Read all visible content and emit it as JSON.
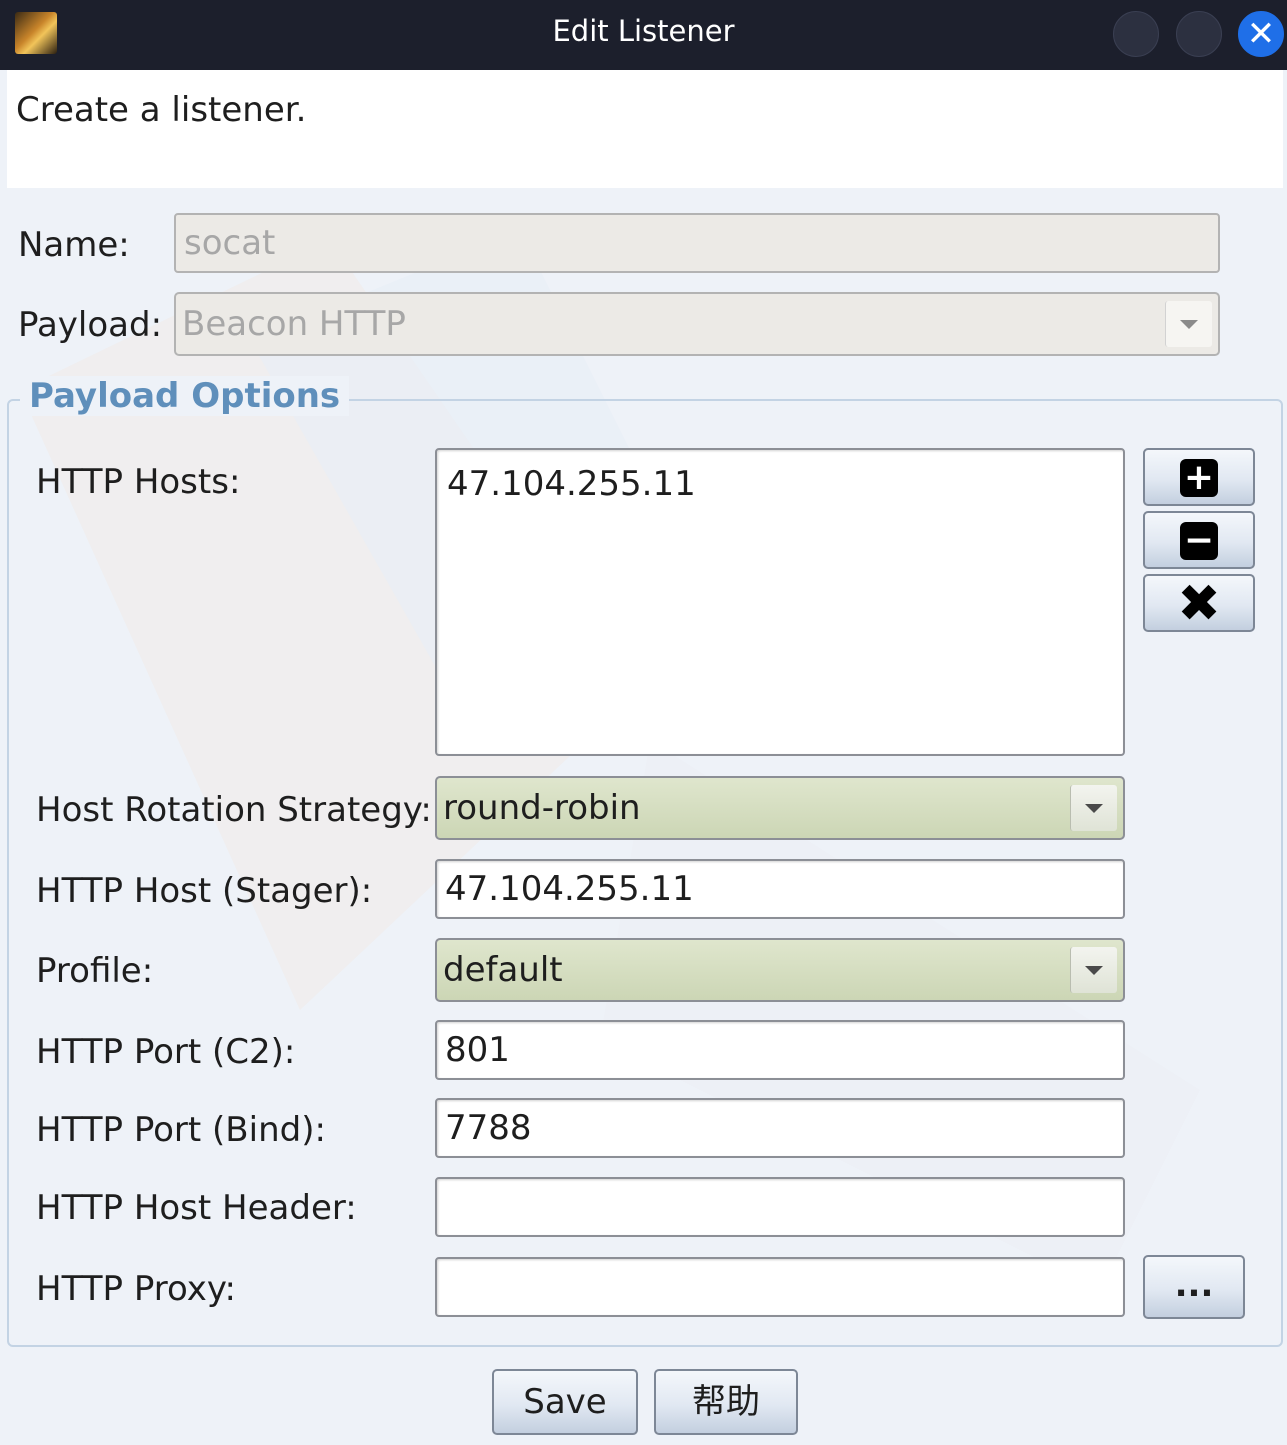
{
  "window": {
    "title": "Edit Listener",
    "close_glyph": "✕",
    "icon": "app-icon"
  },
  "description": "Create a listener.",
  "name_field": {
    "label": "Name:",
    "value": "socat"
  },
  "payload_field": {
    "label": "Payload:",
    "value": "Beacon HTTP"
  },
  "payload_options": {
    "title": "Payload Options",
    "http_hosts": {
      "label": "HTTP Hosts:",
      "items": [
        "47.104.255.11"
      ],
      "add_glyph": "+",
      "remove_glyph": "−",
      "clear_glyph": "✖"
    },
    "host_rotation": {
      "label": "Host Rotation Strategy:",
      "value": "round-robin"
    },
    "http_host_stager": {
      "label": "HTTP Host (Stager):",
      "value": "47.104.255.11"
    },
    "profile": {
      "label": "Profile:",
      "value": "default"
    },
    "http_port_c2": {
      "label": "HTTP Port (C2):",
      "value": "801"
    },
    "http_port_bind": {
      "label": "HTTP Port (Bind):",
      "value": "7788"
    },
    "http_host_header": {
      "label": "HTTP Host Header:",
      "value": ""
    },
    "http_proxy": {
      "label": "HTTP Proxy:",
      "value": "",
      "browse_label": "..."
    }
  },
  "buttons": {
    "save": "Save",
    "help": "帮助"
  },
  "colors": {
    "titlebar": "#1c1f2c",
    "close_button": "#1f6fe8",
    "group_title": "#5f8fbb",
    "combo_bg": "#d6debf",
    "background": "#eef2f8"
  }
}
